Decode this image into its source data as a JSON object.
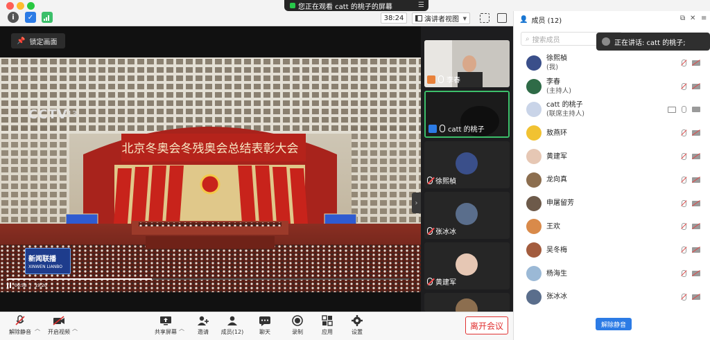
{
  "share_banner": {
    "text": "您正在观看 catt 的桃子的屏幕"
  },
  "header": {
    "timer": "38:24",
    "view_mode": "演讲者视图"
  },
  "stage": {
    "lock_label": "锁定画面",
    "broadcast": {
      "channel_logo": "CCTV",
      "channel_number": "13",
      "banner_text": "北京冬奥会冬残奥会总结表彰大会",
      "program_title": "新闻联播",
      "program_subtitle": "XINWEN LIANBO",
      "time_elapsed": "06:58",
      "time_total": "19:20",
      "progress": 0.36
    }
  },
  "thumbnails": [
    {
      "name": "李春",
      "mic_muted": false,
      "badge_color": "#e8813a",
      "active": false
    },
    {
      "name": "catt 的桃子",
      "mic_muted": false,
      "badge_color": "#2c7be5",
      "active": true
    },
    {
      "name": "徐熙楨",
      "mic_muted": true,
      "active": false
    },
    {
      "name": "张冰冰",
      "mic_muted": true,
      "active": false
    },
    {
      "name": "黄建军",
      "mic_muted": true,
      "active": false
    }
  ],
  "toolbar": {
    "unmute": "解除静音",
    "start_video": "开启视频",
    "share_screen": "共享屏幕",
    "invite": "邀请",
    "members": "成员(12)",
    "chat": "聊天",
    "record": "录制",
    "apps": "应用",
    "settings": "设置",
    "leave": "离开会议"
  },
  "panel": {
    "title": "成员 (12)",
    "search_placeholder": "搜索成员",
    "speaking": "正在讲话: catt 的桃子;",
    "unmute_button": "解除静音",
    "participants": [
      {
        "name": "徐熙楨",
        "role": "(我)",
        "avatar_color": "#3a4f8a",
        "mic_muted": true,
        "cam_off": true
      },
      {
        "name": "李春",
        "role": "(主持人)",
        "avatar_color": "#2f6b47",
        "mic_muted": true,
        "cam_off": true
      },
      {
        "name": "catt 的桃子",
        "role": "(联席主持人)",
        "avatar_color": "#c9d4e8",
        "mic_muted": false,
        "cam_off": false,
        "sharing": true
      },
      {
        "name": "敖燕环",
        "role": "",
        "avatar_color": "#f1c232",
        "mic_muted": true,
        "cam_off": true
      },
      {
        "name": "黄建军",
        "role": "",
        "avatar_color": "#e6c7b4",
        "mic_muted": true,
        "cam_off": true
      },
      {
        "name": "龙向真",
        "role": "",
        "avatar_color": "#8c6e4f",
        "mic_muted": true,
        "cam_off": true
      },
      {
        "name": "申屠留芳",
        "role": "",
        "avatar_color": "#6d5a4a",
        "mic_muted": true,
        "cam_off": true
      },
      {
        "name": "王欢",
        "role": "",
        "avatar_color": "#d98a4a",
        "mic_muted": true,
        "cam_off": true
      },
      {
        "name": "吴冬梅",
        "role": "",
        "avatar_color": "#a35c3e",
        "mic_muted": true,
        "cam_off": true
      },
      {
        "name": "杨海生",
        "role": "",
        "avatar_color": "#9bb9d6",
        "mic_muted": true,
        "cam_off": true
      },
      {
        "name": "张冰冰",
        "role": "",
        "avatar_color": "#5a6e8c",
        "mic_muted": true,
        "cam_off": true
      }
    ]
  }
}
